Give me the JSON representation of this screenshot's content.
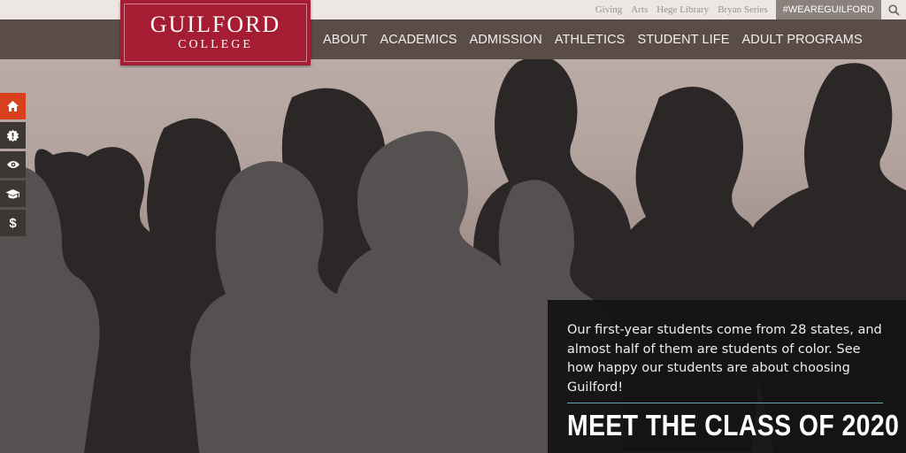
{
  "utility_bar": {
    "links": [
      "Giving",
      "Arts",
      "Hege Library",
      "Bryan Series"
    ],
    "hashtag": "#WEAREGUILFORD",
    "search_icon": "search-icon"
  },
  "logo": {
    "main": "GUILFORD",
    "sub": "COLLEGE",
    "color": "#a51d32"
  },
  "nav": {
    "items": [
      "ABOUT",
      "ACADEMICS",
      "ADMISSION",
      "ATHLETICS",
      "STUDENT LIFE",
      "ADULT PROGRAMS"
    ]
  },
  "side_tabs": [
    {
      "icon": "home-icon",
      "active": true
    },
    {
      "icon": "badge-icon",
      "active": false
    },
    {
      "icon": "eye-icon",
      "active": false
    },
    {
      "icon": "graduation-cap-icon",
      "active": false
    },
    {
      "icon": "dollar-icon",
      "glyph": "$",
      "active": false
    }
  ],
  "hero": {
    "body": "Our first-year students come from 28 states, and almost half of them are students of color. See how happy our students are about choosing Guilford!",
    "heading": "MEET THE CLASS OF 2020"
  },
  "colors": {
    "nav_bg": "#5a4d48",
    "active_tab": "#d8401e",
    "panel_bg": "#141212",
    "rule": "#6aa0b8"
  }
}
